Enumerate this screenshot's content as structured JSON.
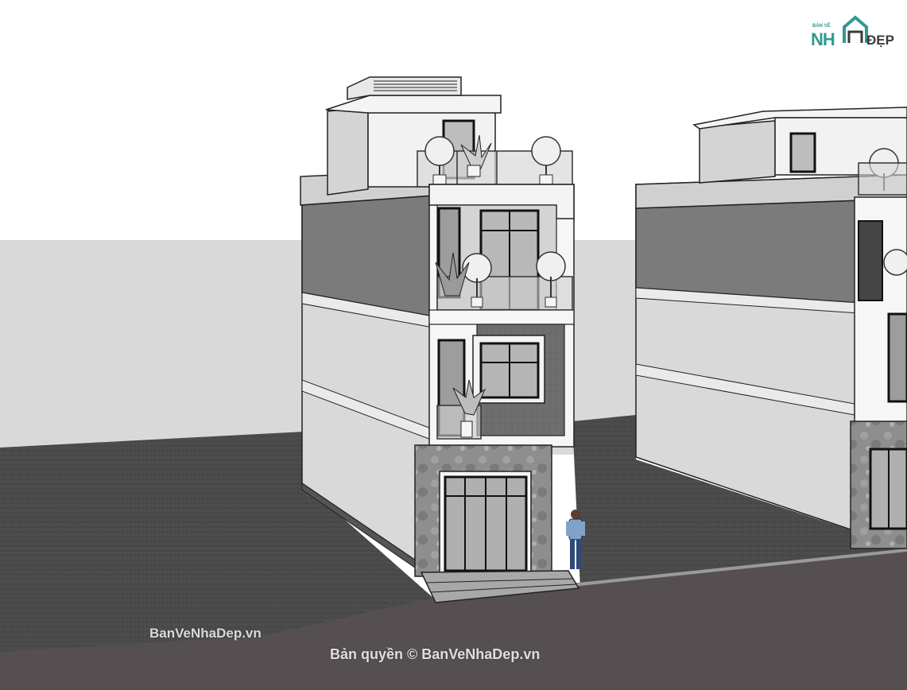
{
  "watermarks": {
    "site_label": "BanVeNhaDep.vn",
    "copyright_label": "Bản quyền © BanVeNhaDep.vn"
  },
  "logo": {
    "top_text": "BẢN VẼ",
    "main_text": "NH",
    "suffix_text": "ĐẸP"
  },
  "colors": {
    "sky": "#ffffff",
    "ground_far": "#d9d9d9",
    "pavement": "#4a4a4a",
    "road": "#564f52",
    "wall_light": "#d6d6d6",
    "wall_dark": "#7d7d7d",
    "stone": "#8f8f8f",
    "brand": "#2e9b8f"
  }
}
